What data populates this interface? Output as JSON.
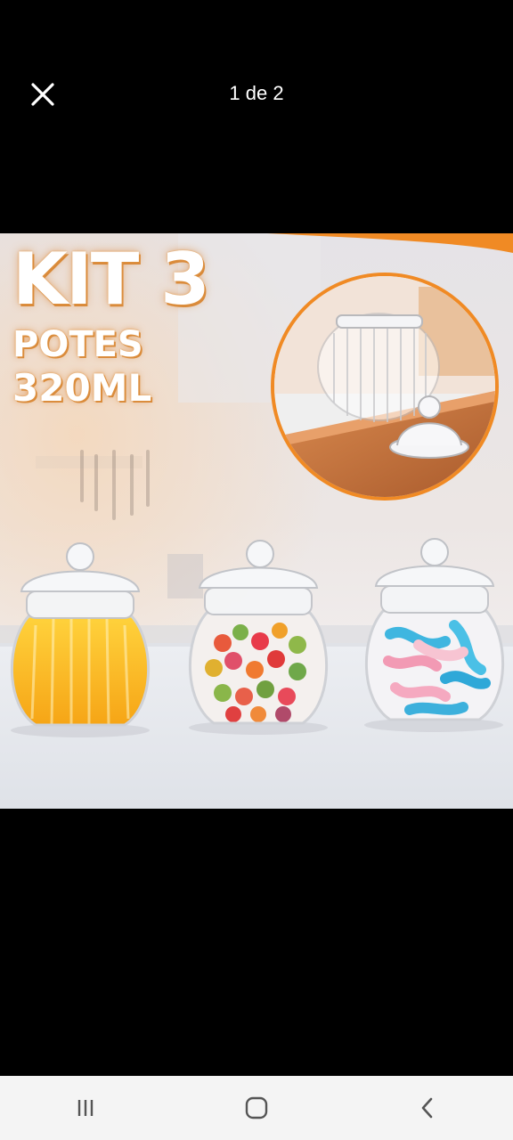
{
  "top_bar": {
    "counter_text": "1 de 2",
    "close_icon": "close-icon"
  },
  "promo": {
    "kit_label": "KIT 3",
    "potes_label": "POTES",
    "volume_label": "320ML"
  },
  "colors": {
    "background": "#000000",
    "accent_orange": "#f08a24",
    "nav_background": "#f4f4f4"
  },
  "nav": {
    "recents_icon": "recents-icon",
    "home_icon": "home-icon",
    "back_icon": "back-icon"
  }
}
